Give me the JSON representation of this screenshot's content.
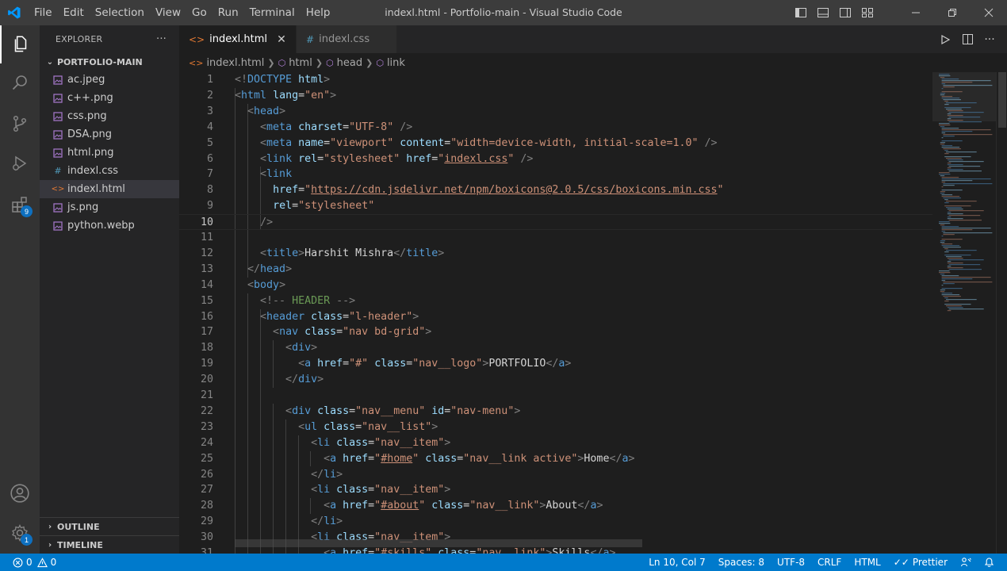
{
  "titlebar": {
    "menus": [
      "File",
      "Edit",
      "Selection",
      "View",
      "Go",
      "Run",
      "Terminal",
      "Help"
    ],
    "title": "indexl.html - Portfolio-main - Visual Studio Code"
  },
  "activitybar": {
    "extensions_badge": "9",
    "accounts_badge": "1"
  },
  "sidebar": {
    "header": "EXPLORER",
    "more": "···",
    "folder": "PORTFOLIO-MAIN",
    "files": [
      {
        "name": "ac.jpeg",
        "type": "image"
      },
      {
        "name": "c++.png",
        "type": "image"
      },
      {
        "name": "css.png",
        "type": "image"
      },
      {
        "name": "DSA.png",
        "type": "image"
      },
      {
        "name": "html.png",
        "type": "image"
      },
      {
        "name": "indexl.css",
        "type": "css"
      },
      {
        "name": "indexl.html",
        "type": "html",
        "selected": true
      },
      {
        "name": "js.png",
        "type": "image"
      },
      {
        "name": "python.webp",
        "type": "image"
      }
    ],
    "outline": "OUTLINE",
    "timeline": "TIMELINE"
  },
  "tabs": [
    {
      "label": "indexl.html",
      "icon": "<>",
      "active": true,
      "close": "✕"
    },
    {
      "label": "indexl.css",
      "icon": "#",
      "active": false
    }
  ],
  "breadcrumb": {
    "file": "indexl.html",
    "items": [
      "html",
      "head",
      "link"
    ]
  },
  "editor": {
    "current_line": 10,
    "visible_first_line": 1,
    "last_partial_line": 31,
    "lines": [
      "<!DOCTYPE html>",
      "<html lang=\"en\">",
      "  <head>",
      "    <meta charset=\"UTF-8\" />",
      "    <meta name=\"viewport\" content=\"width=device-width, initial-scale=1.0\" />",
      "    <link rel=\"stylesheet\" href=\"indexl.css\" />",
      "    <link",
      "      href=\"https://cdn.jsdelivr.net/npm/boxicons@2.0.5/css/boxicons.min.css\"",
      "      rel=\"stylesheet\"",
      "    />",
      "",
      "    <title>Harshit Mishra</title>",
      "  </head>",
      "  <body>",
      "    <!-- HEADER -->",
      "    <header class=\"l-header\">",
      "      <nav class=\"nav bd-grid\">",
      "        <div>",
      "          <a href=\"#\" class=\"nav__logo\">PORTFOLIO</a>",
      "        </div>",
      "",
      "        <div class=\"nav__menu\" id=\"nav-menu\">",
      "          <ul class=\"nav__list\">",
      "            <li class=\"nav__item\">",
      "              <a href=\"#home\" class=\"nav__link active\">Home</a>",
      "            </li>",
      "            <li class=\"nav__item\">",
      "              <a href=\"#about\" class=\"nav__link\">About</a>",
      "            </li>",
      "            <li class=\"nav__item\">",
      "              <a href=\"#skills\" class=\"nav__link\">Skills</a>"
    ]
  },
  "statusbar": {
    "errors": "0",
    "warnings": "0",
    "position": "Ln 10, Col 7",
    "spaces": "Spaces: 8",
    "encoding": "UTF-8",
    "eol": "CRLF",
    "language": "HTML",
    "formatter": "Prettier"
  },
  "colors": {
    "accent": "#007acc",
    "tag": "#569cd6",
    "attribute": "#9cdcfe",
    "string": "#ce9178",
    "comment": "#6a9955"
  }
}
